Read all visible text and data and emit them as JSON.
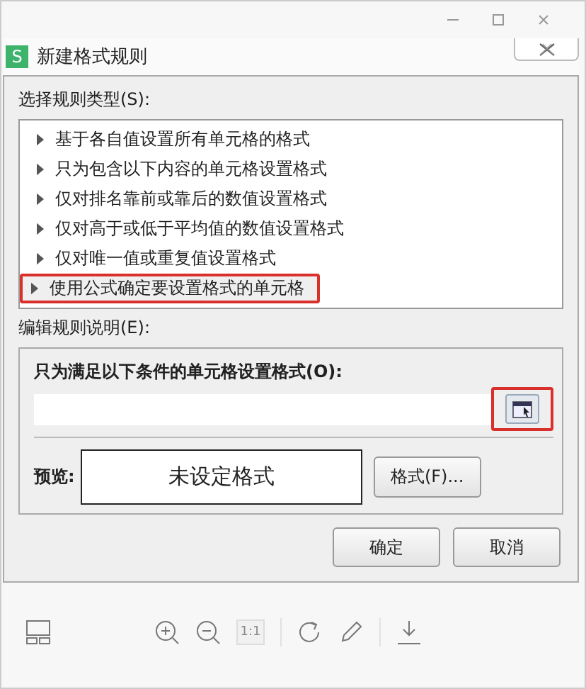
{
  "viewer": {
    "toolbar": [
      {
        "kind": "layout"
      },
      {
        "kind": "zoom-in"
      },
      {
        "kind": "zoom-out"
      },
      {
        "kind": "actual-size",
        "label": "1:1",
        "disabled": true
      },
      {
        "kind": "rotate"
      },
      {
        "kind": "edit"
      },
      {
        "kind": "download"
      }
    ]
  },
  "dialog": {
    "app_badge": "S",
    "title": "新建格式规则",
    "rule_type_label": "选择规则类型(S):",
    "rule_types": [
      {
        "label": "基于各自值设置所有单元格的格式",
        "selected": false,
        "highlighted": false
      },
      {
        "label": "只为包含以下内容的单元格设置格式",
        "selected": false,
        "highlighted": false
      },
      {
        "label": "仅对排名靠前或靠后的数值设置格式",
        "selected": false,
        "highlighted": false
      },
      {
        "label": "仅对高于或低于平均值的数值设置格式",
        "selected": false,
        "highlighted": false
      },
      {
        "label": "仅对唯一值或重复值设置格式",
        "selected": false,
        "highlighted": false
      },
      {
        "label": "使用公式确定要设置格式的单元格",
        "selected": true,
        "highlighted": true
      }
    ],
    "description_label": "编辑规则说明(E):",
    "condition_label": "只为满足以下条件的单元格设置格式(O):",
    "range_button_highlighted": true,
    "preview_label": "预览:",
    "preview_text": "未设定格式",
    "format_button": "格式(F)...",
    "buttons": [
      "确定",
      "取消"
    ]
  }
}
